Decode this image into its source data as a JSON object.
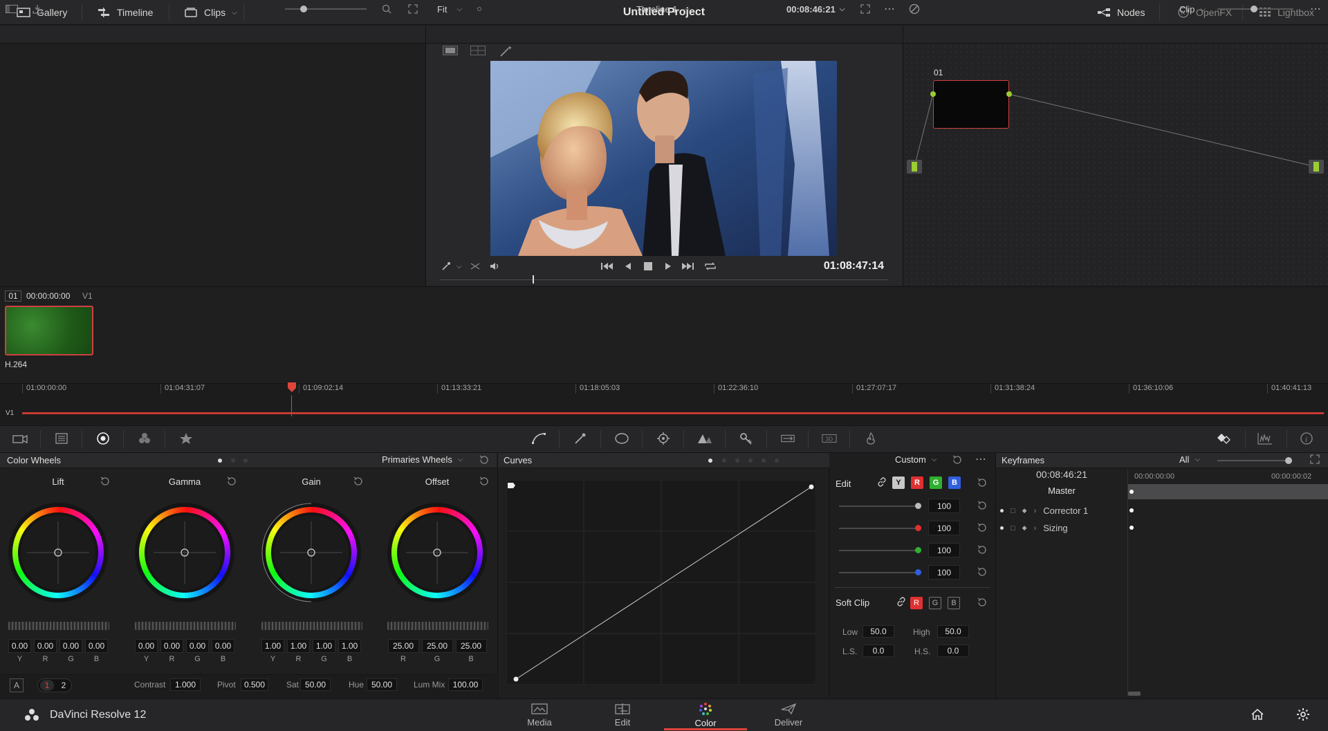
{
  "project_title": "Untitled Project",
  "topbar": {
    "gallery": "Gallery",
    "timeline": "Timeline",
    "clips": "Clips",
    "nodes": "Nodes",
    "openfx": "OpenFX",
    "lightbox": "Lightbox"
  },
  "viewer": {
    "fit": "Fit",
    "timeline_name": "Timeline 1",
    "timecode_top": "00:08:46:21",
    "timecode": "01:08:47:14"
  },
  "nodegraph": {
    "mode": "Clip",
    "node_label": "01"
  },
  "clip": {
    "index": "01",
    "timecode": "00:00:00:00",
    "track": "V1",
    "codec": "H.264"
  },
  "timeline": {
    "track": "V1",
    "ticks": [
      "01:00:00:00",
      "01:04:31:07",
      "01:09:02:14",
      "01:13:33:21",
      "01:18:05:03",
      "01:22:36:10",
      "01:27:07:17",
      "01:31:38:24",
      "01:36:10:06",
      "01:40:41:13"
    ]
  },
  "color_wheels": {
    "title": "Color Wheels",
    "mode": "Primaries Wheels",
    "wheels": [
      {
        "name": "Lift",
        "values": [
          "0.00",
          "0.00",
          "0.00",
          "0.00"
        ],
        "labels": [
          "Y",
          "R",
          "G",
          "B"
        ]
      },
      {
        "name": "Gamma",
        "values": [
          "0.00",
          "0.00",
          "0.00",
          "0.00"
        ],
        "labels": [
          "Y",
          "R",
          "G",
          "B"
        ]
      },
      {
        "name": "Gain",
        "values": [
          "1.00",
          "1.00",
          "1.00",
          "1.00"
        ],
        "labels": [
          "Y",
          "R",
          "G",
          "B"
        ]
      },
      {
        "name": "Offset",
        "values": [
          "25.00",
          "25.00",
          "25.00"
        ],
        "labels": [
          "R",
          "G",
          "B"
        ]
      }
    ],
    "bottom": {
      "a_label": "A",
      "page1": "1",
      "page2": "2",
      "contrast_label": "Contrast",
      "contrast": "1.000",
      "pivot_label": "Pivot",
      "pivot": "0.500",
      "sat_label": "Sat",
      "sat": "50.00",
      "hue_label": "Hue",
      "hue": "50.00",
      "lummix_label": "Lum Mix",
      "lummix": "100.00"
    }
  },
  "curves": {
    "title": "Curves",
    "mode": "Custom",
    "edit_label": "Edit",
    "channels": [
      "Y",
      "R",
      "G",
      "B"
    ],
    "intensity": [
      "100",
      "100",
      "100",
      "100"
    ],
    "channel_colors": [
      "#c8c8c8",
      "#e03030",
      "#30b030",
      "#3060e0"
    ],
    "soft_clip_label": "Soft Clip",
    "soft_channels": [
      "R",
      "G",
      "B"
    ],
    "low_label": "Low",
    "low": "50.0",
    "high_label": "High",
    "high": "50.0",
    "ls_label": "L.S.",
    "ls": "0.0",
    "hs_label": "H.S.",
    "hs": "0.0"
  },
  "keyframes": {
    "title": "Keyframes",
    "filter": "All",
    "timecode": "00:08:46:21",
    "ruler_start": "00:00:00:00",
    "ruler_end": "00:00:00:02",
    "tracks": [
      "Master",
      "Corrector 1",
      "Sizing"
    ]
  },
  "bottombar": {
    "app_name": "DaVinci Resolve 12",
    "pages": [
      "Media",
      "Edit",
      "Color",
      "Deliver"
    ],
    "active_page": "Color",
    "accent": "#e0453a"
  }
}
